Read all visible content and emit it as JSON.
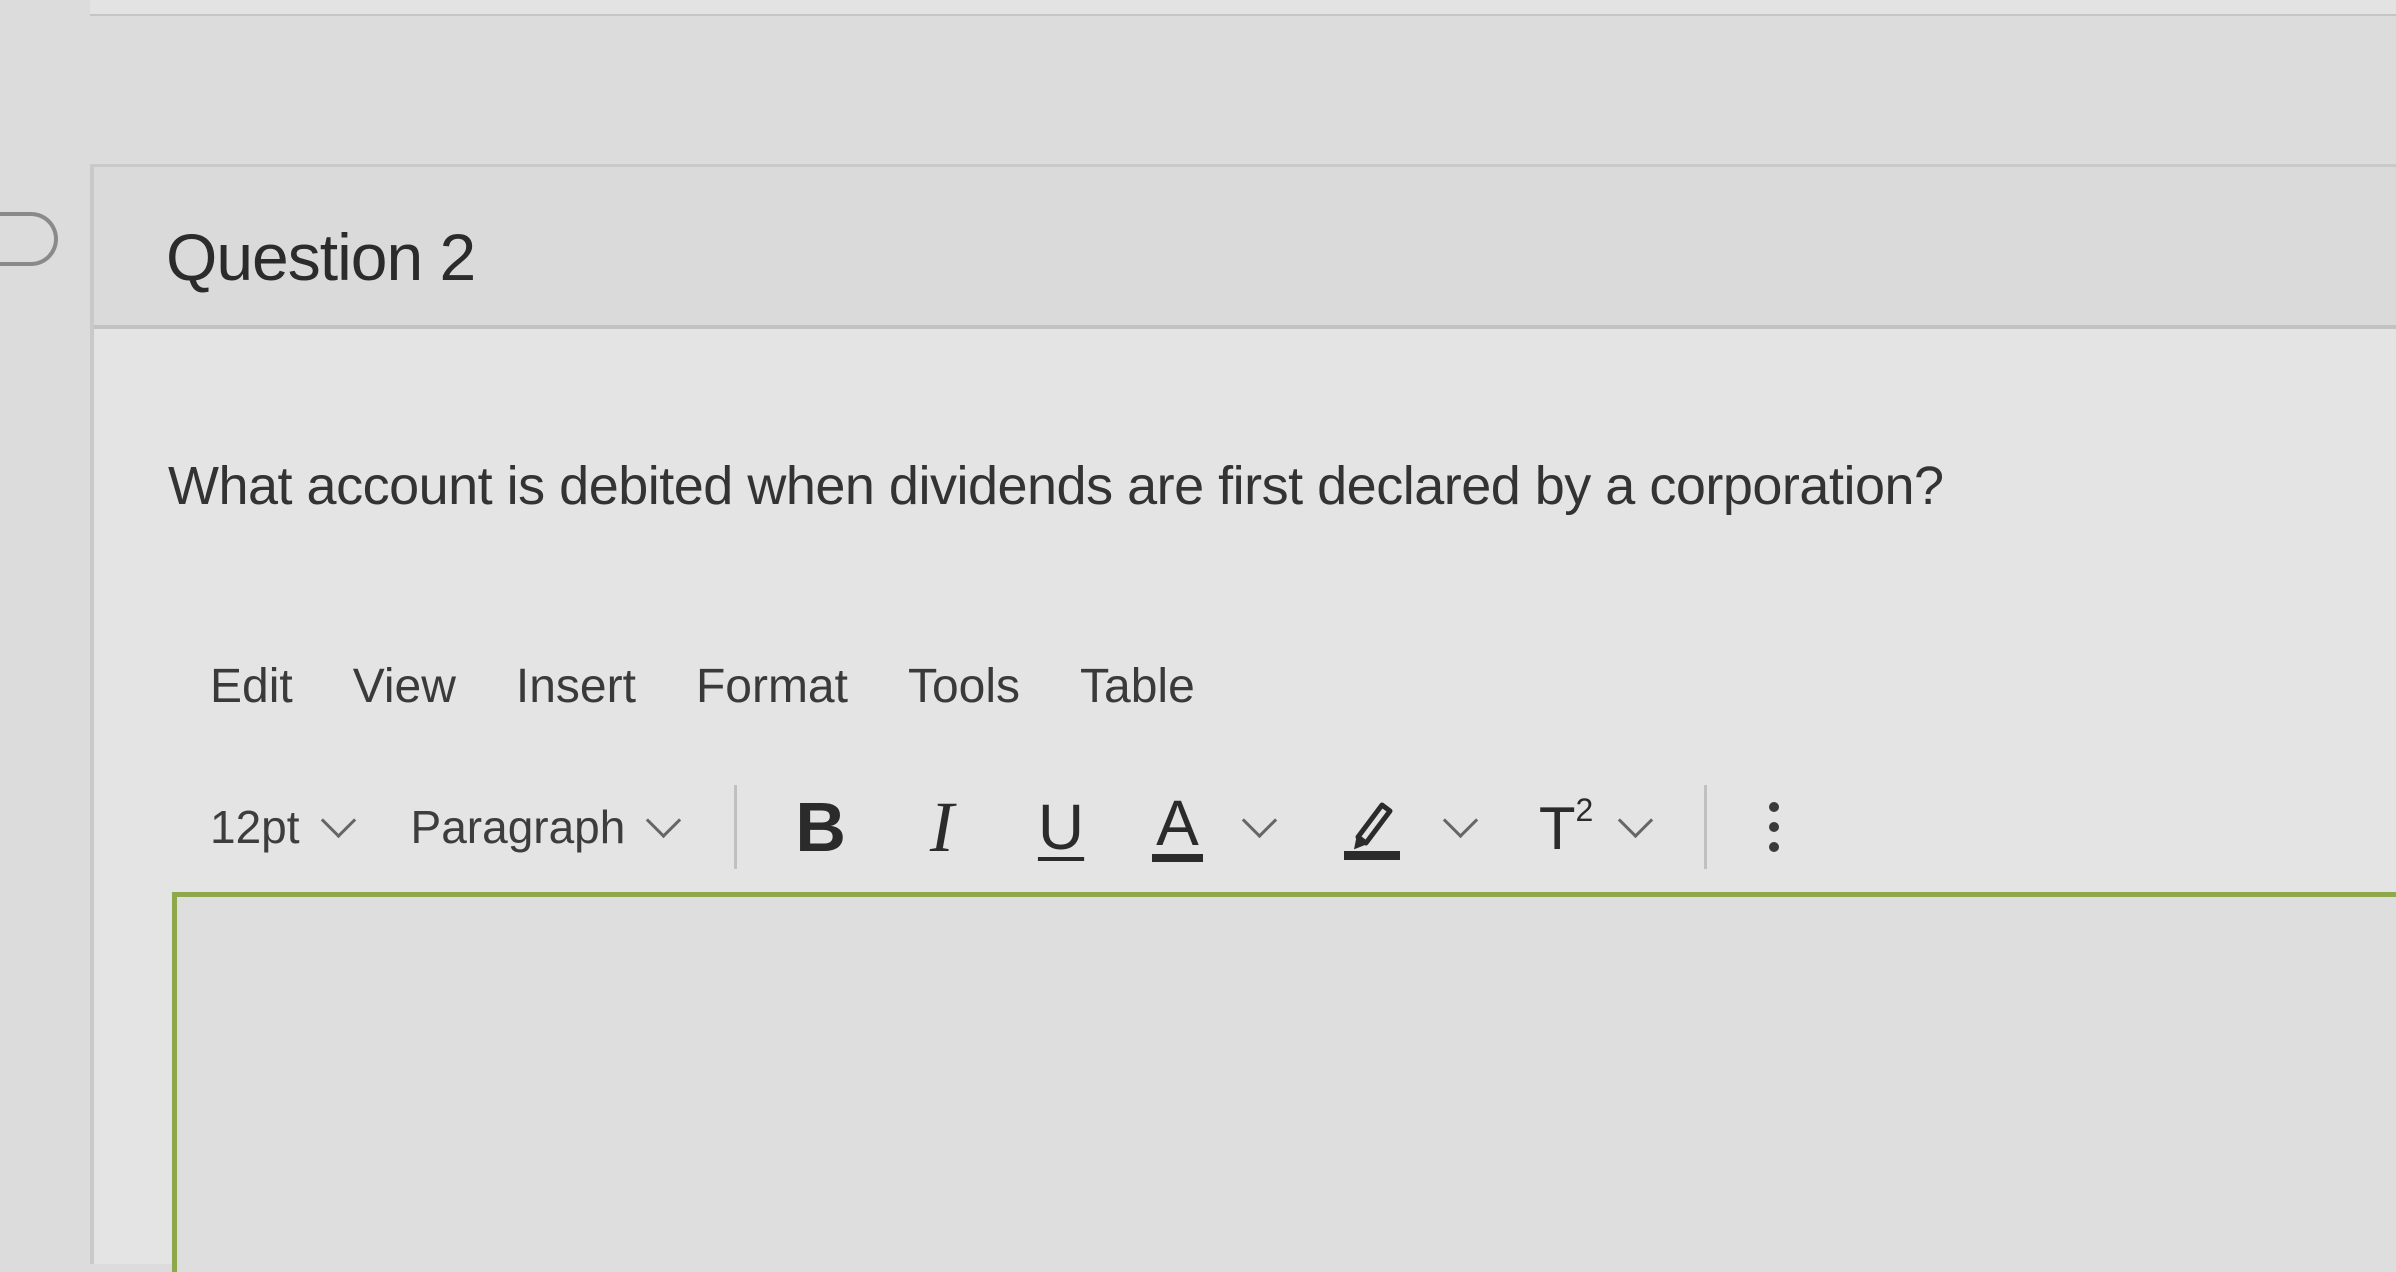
{
  "question": {
    "title": "Question 2",
    "text": "What account is debited when dividends are first declared by a corporation?"
  },
  "menu": {
    "items": [
      "Edit",
      "View",
      "Insert",
      "Format",
      "Tools",
      "Table"
    ]
  },
  "toolbar": {
    "font_size": "12pt",
    "block_format": "Paragraph",
    "bold_glyph": "B",
    "italic_glyph": "I",
    "underline_glyph": "U",
    "text_color_glyph": "A",
    "superscript_glyph": "T",
    "superscript_mark": "2"
  },
  "editor": {
    "content": ""
  },
  "icons": {
    "flag": "flag-outline-icon",
    "bold": "bold-icon",
    "italic": "italic-icon",
    "underline": "underline-icon",
    "text_color": "text-color-icon",
    "highlight": "highlight-pen-icon",
    "superscript": "superscript-icon",
    "more": "more-vertical-icon"
  },
  "colors": {
    "editor_focus_border": "#8ea94c"
  }
}
